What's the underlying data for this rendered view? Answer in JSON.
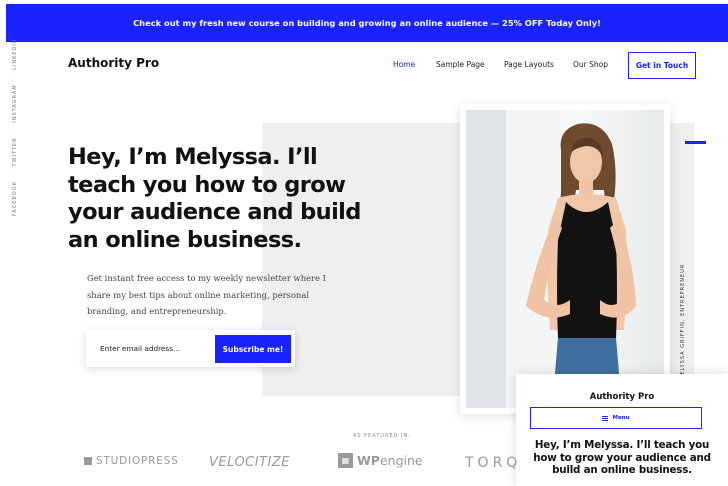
{
  "announcement": "Check out my fresh new course on building and growing an online audience — 25% OFF Today Only!",
  "social": [
    "FACEBOOK",
    "TWITTER",
    "INSTAGRAM",
    "LINKEDIN"
  ],
  "header": {
    "logo": "Authority Pro",
    "nav": [
      {
        "label": "Home",
        "active": true
      },
      {
        "label": "Sample Page",
        "active": false
      },
      {
        "label": "Page Layouts",
        "active": false
      },
      {
        "label": "Our Shop",
        "active": false
      }
    ],
    "cta": "Get in Touch"
  },
  "hero": {
    "title": "Hey, I’m Melyssa. I’ll teach you how to grow your audience and build an online business.",
    "subtitle": "Get instant free access to my weekly newsletter where I share my best tips about online marketing, personal branding, and entrepreneurship.",
    "email_placeholder": "Enter email address...",
    "subscribe": "Subscribe me!"
  },
  "photo_caption": "MELYSSA GRIFFIN, ENTREPRENEUR",
  "mobile_preview": {
    "logo": "Authority Pro",
    "menu": "Menu",
    "title": "Hey, I’m Melyssa. I’ll teach you how to grow your audience and build an online business."
  },
  "featured": {
    "label": "AS FEATURED IN:",
    "brands": {
      "studiopress": "STUDIOPRESS",
      "velocitize": "VELOCITIZE",
      "wpengine_bold": "WP",
      "wpengine_rest": "engine",
      "torque": "TORQ"
    }
  },
  "colors": {
    "accent": "#1a22ff",
    "panel": "#efefef",
    "text": "#111111"
  }
}
